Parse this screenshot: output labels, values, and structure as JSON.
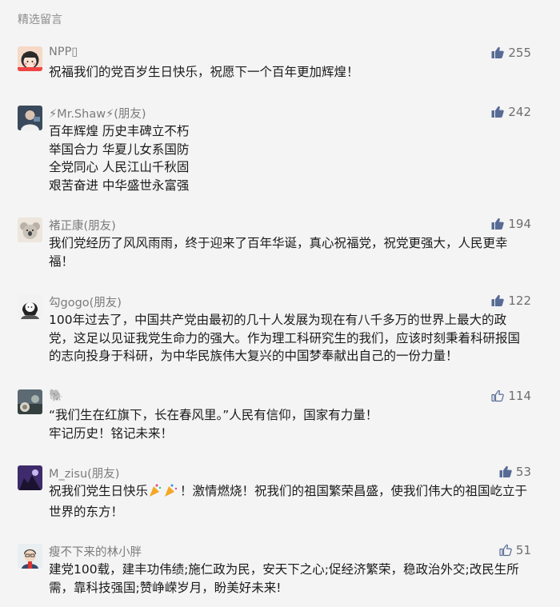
{
  "section_title": "精选留言",
  "comments": [
    {
      "nickname": "NPP▯",
      "likes": "255",
      "liked": true,
      "avatar_icon": "cartoon-girl-avatar",
      "content": "祝福我们的党百岁生日快乐，祝愿下一个百年更加辉煌！"
    },
    {
      "nickname": "⚡Mr.Shaw⚡(朋友)",
      "likes": "242",
      "liked": true,
      "avatar_icon": "person-photo-avatar",
      "content": "百年辉煌 历史丰碑立不朽\n举国合力 华夏儿女系国防\n全党同心 人民江山千秋固\n艰苦奋进 中华盛世永富强"
    },
    {
      "nickname": "褚正康(朋友)",
      "likes": "194",
      "liked": true,
      "avatar_icon": "koala-avatar",
      "content": "我们党经历了风风雨雨，终于迎来了百年华诞，真心祝福党，祝党更强大，人民更幸福！"
    },
    {
      "nickname": "勾gogo(朋友)",
      "likes": "122",
      "liked": true,
      "avatar_icon": "sketch-girl-avatar",
      "content": "100年过去了，中国共产党由最初的几十人发展为现在有八千多万的世界上最大的政党，这足以见证我党生命力的强大。作为理工科研究生的我们，应该时刻秉着科研报国的志向投身于科研，为中华民族伟大复兴的中国梦奉献出自己的一份力量！"
    },
    {
      "nickname": "🐘",
      "likes": "114",
      "liked": false,
      "avatar_icon": "photo-avatar",
      "content": "“我们生在红旗下，长在春风里。”人民有信仰，国家有力量！\n牢记历史！铭记未来！"
    },
    {
      "nickname": "M_zisu(朋友)",
      "likes": "53",
      "liked": true,
      "avatar_icon": "purple-night-avatar",
      "content_before_emoji": "祝我们党生日快乐",
      "emoji": "party-popper-icon",
      "content_after_emoji": "！激情燃烧！祝我们的祖国繁荣昌盛，使我们伟大的祖国屹立于世界的东方！"
    },
    {
      "nickname": "瘦不下来的林小胖",
      "likes": "51",
      "liked": false,
      "avatar_icon": "cartoon-boy-avatar",
      "content": "建党100载，建丰功伟绩;施仁政为民，安天下之心;促经济繁荣，稳政治外交;改民生所需，靠科技强国;赞峥嵘岁月，盼美好未来!"
    }
  ],
  "colors": {
    "like_filled": "#576b95",
    "like_outline": "#576b95",
    "text": "#1a1a1a",
    "muted": "#7b7b7b",
    "background": "#f4f4f4"
  }
}
